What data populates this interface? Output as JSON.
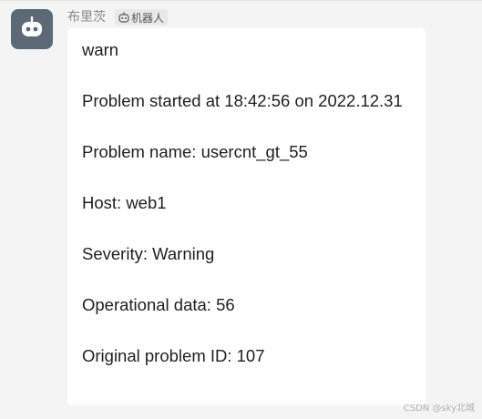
{
  "chat": {
    "sender_name": "布里茨",
    "bot_badge_label": "机器人",
    "avatar_icon": "robot-icon",
    "badge_icon": "robot-icon",
    "message_lines": [
      "warn",
      "Problem started at 18:42:56 on 2022.12.31",
      "Problem name: usercnt_gt_55",
      "Host: web1",
      "Severity: Warning",
      "Operational data: 56",
      "Original problem ID: 107"
    ]
  },
  "watermark": "CSDN @sky北城",
  "colors": {
    "page_background": "#f4f4f4",
    "bubble_background": "#ffffff",
    "avatar_background": "#5c6a77",
    "text": "#1f1f1f",
    "sender_text": "#8a8a8a"
  }
}
